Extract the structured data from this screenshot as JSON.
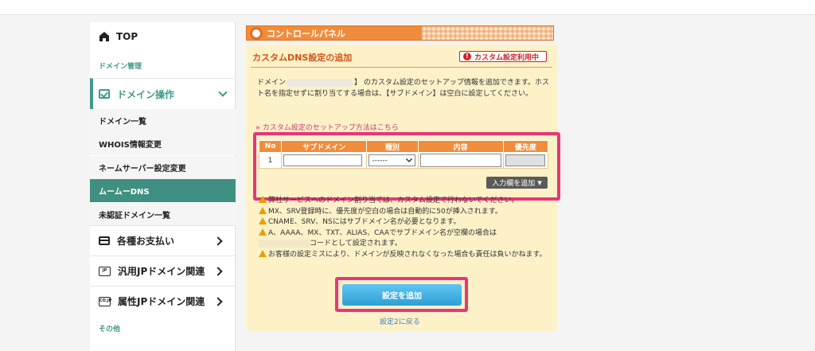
{
  "sidebar": {
    "top": "TOP",
    "section_domain": "ドメイン管理",
    "domain_operation": "ドメイン操作",
    "items": [
      {
        "label": "ドメイン一覧"
      },
      {
        "label": "WHOIS情報変更"
      },
      {
        "label": "ネームサーバー設定変更"
      },
      {
        "label": "ムームーDNS",
        "active": true
      },
      {
        "label": "未認証ドメイン一覧"
      }
    ],
    "payments": "各種お支払い",
    "jp_general": "汎用JPドメイン関連",
    "jp_attribute": "属性JPドメイン関連",
    "section_other": "その他",
    "jp_icon_text": "JP",
    "cojp_icon_text": "CO.JP"
  },
  "control_panel": {
    "title": "コントロールパネル"
  },
  "panel": {
    "title": "カスタムDNS設定の追加",
    "badge": "カスタム設定利用中",
    "desc_prefix": "ドメイン",
    "desc_suffix": "】 のカスタム設定のセットアップ情報を追加できます。ホスト名を指定せずに割り当てする場合は、【サブドメイン】は空白に設定してください。",
    "howto_link": "カスタム設定のセットアップ方法はこちら"
  },
  "table": {
    "headers": [
      "No",
      "サブドメイン",
      "種別",
      "内容",
      "優先度"
    ],
    "row_no": "1",
    "type_value": "------",
    "add_row_button": "入力欄を追加"
  },
  "notes": [
    "弊社サービスへのドメイン割り当ては、カスタム設定で行わないでください。",
    "MX、SRV登録時に、優先度が空白の場合は自動的に50が挿入されます。",
    "CNAME、SRV、NSにはサブドメイン名が必要となります。",
    "A、AAAA、MX、TXT、ALIAS、CAAでサブドメイン名が空欄の場合は",
    "コードとして設定されます。",
    "お客様の設定ミスにより、ドメインが反映されなくなった場合も責任は負いかねます。"
  ],
  "actions": {
    "submit": "設定を追加",
    "back": "設定2に戻る"
  },
  "colors": {
    "accent_green": "#3f8f82",
    "orange": "#f08d3c",
    "highlight_pink": "#e83778",
    "button_blue": "#2f9fd5"
  }
}
